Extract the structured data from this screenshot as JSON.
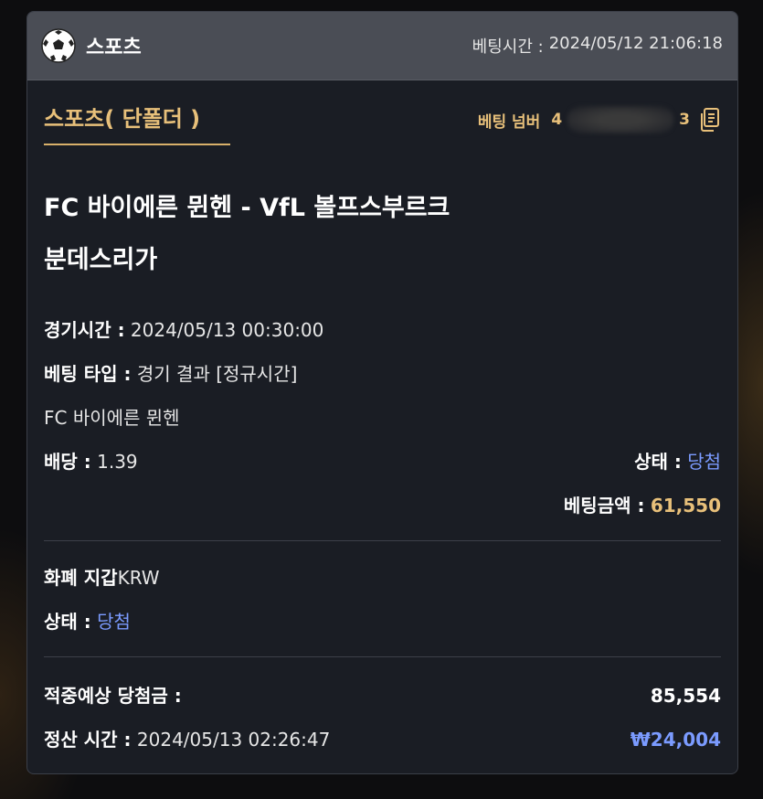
{
  "header": {
    "title": "스포츠",
    "bet_time_label": "베팅시간 :",
    "bet_time_value": "2024/05/12 21:06:18"
  },
  "tab": {
    "label": "스포츠( 단폴더 )"
  },
  "bet_number": {
    "label": "베팅 넘버",
    "visible_fragment_start": "4",
    "visible_fragment_end": "3"
  },
  "match": {
    "title": "FC 바이에른 뮌헨 - VfL 볼프스부르크",
    "league": "분데스리가"
  },
  "details": {
    "game_time_label": "경기시간 :",
    "game_time_value": "2024/05/13 00:30:00",
    "bet_type_label": "베팅 타입 :",
    "bet_type_value": "경기 결과 [정규시간]",
    "selection": "FC 바이에른 뮌헨",
    "odds_label": "배당 :",
    "odds_value": "1.39",
    "status_label": "상태 :",
    "status_value": "당첨",
    "amount_label": "베팅금액 :",
    "amount_value": "61,550"
  },
  "wallet": {
    "currency_label": "화폐 지갑",
    "currency_value": "KRW",
    "status_label": "상태 :",
    "status_value": "당첨"
  },
  "summary": {
    "expected_label": "적중예상 당첨금 :",
    "expected_value": "85,554",
    "settle_label": "정산 시간 :",
    "settle_value": "2024/05/13 02:26:47",
    "settle_amount": "₩24,004"
  },
  "colors": {
    "accent_gold": "#e8c07a",
    "status_blue": "#7b9bff",
    "card_bg": "#1a1d24",
    "header_bg": "#4a4d55"
  },
  "icons": {
    "sport": "soccer-ball-icon",
    "copy": "copy-icon"
  }
}
